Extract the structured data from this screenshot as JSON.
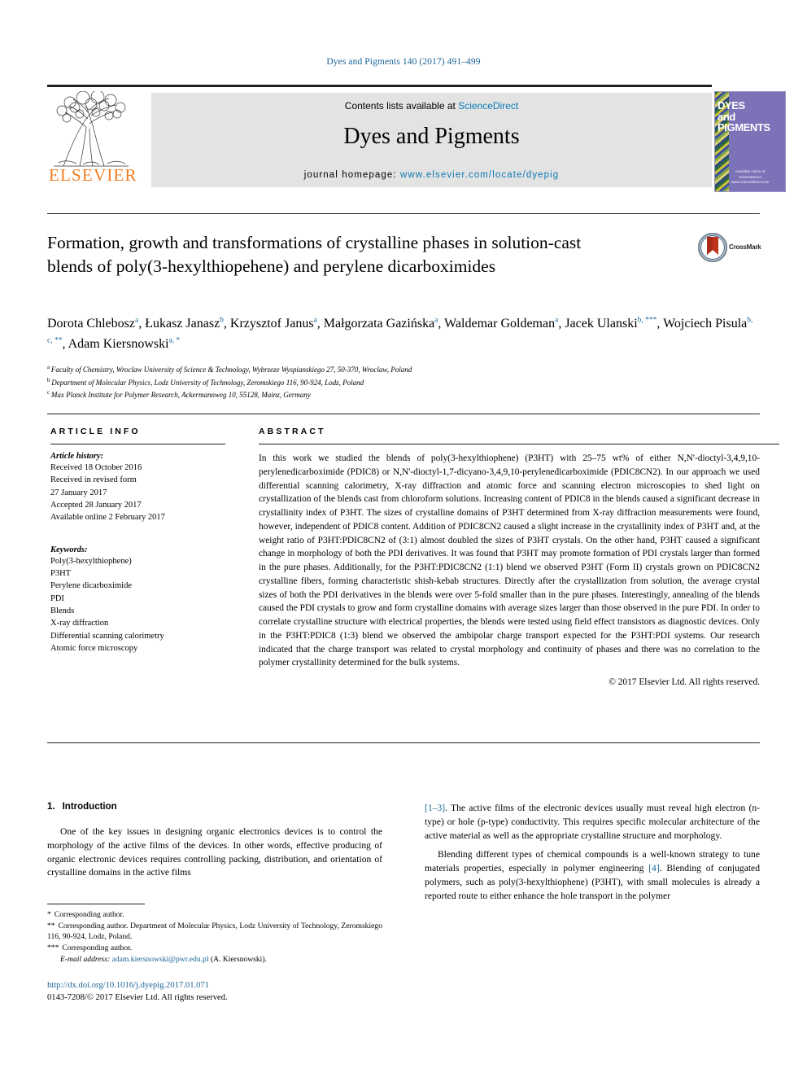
{
  "running_head": "Dyes and Pigments 140 (2017) 491–499",
  "masthead": {
    "contents_prefix": "Contents lists available at ",
    "sciencedirect": "ScienceDirect",
    "journal_title": "Dyes and Pigments",
    "homepage_label": "journal homepage: ",
    "homepage_url": "www.elsevier.com/locate/dyepig",
    "publisher": "ELSEVIER",
    "cover": {
      "line1": "DYES",
      "line2": "and",
      "line3": "PIGMENTS",
      "footer1": "Available online at",
      "footer2": "ScienceDirect",
      "footer3": "www.sciencedirect.com"
    },
    "accent_blue": "#0b7ab5",
    "elsevier_orange": "#f47b20",
    "cover_purple": "#7b72b8"
  },
  "title": "Formation, growth and transformations of crystalline phases in solution-cast blends of poly(3-hexylthiopehene) and perylene dicarboximides",
  "crossmark": {
    "label": "CrossMark"
  },
  "authors": [
    {
      "name": "Dorota Chlebosz",
      "marks": "a",
      "corr": ""
    },
    {
      "name": "Łukasz Janasz",
      "marks": "b",
      "corr": ""
    },
    {
      "name": "Krzysztof Janus",
      "marks": "a",
      "corr": ""
    },
    {
      "name": "Małgorzata Gazińska",
      "marks": "a",
      "corr": ""
    },
    {
      "name": "Waldemar Goldeman",
      "marks": "a",
      "corr": ""
    },
    {
      "name": "Jacek Ulanski",
      "marks": "b, ",
      "corr": "***"
    },
    {
      "name": "Wojciech Pisula",
      "marks": "b, c, ",
      "corr": "**"
    },
    {
      "name": "Adam Kiersnowski",
      "marks": "a, ",
      "corr": "*"
    }
  ],
  "affiliations": [
    {
      "mark": "a",
      "text": "Faculty of Chemistry, Wroclaw University of Science & Technology, Wybrzeze Wyspianskiego 27, 50-370, Wroclaw, Poland"
    },
    {
      "mark": "b",
      "text": "Department of Molecular Physics, Lodz University of Technology, Zeromskiego 116, 90-924, Lodz, Poland"
    },
    {
      "mark": "c",
      "text": "Max Planck Institute for Polymer Research, Ackermannweg 10, 55128, Mainz, Germany"
    }
  ],
  "article_info": {
    "kicker": "ARTICLE INFO",
    "history_label": "Article history:",
    "history": [
      "Received 18 October 2016",
      "Received in revised form",
      "27 January 2017",
      "Accepted 28 January 2017",
      "Available online 2 February 2017"
    ],
    "keywords_label": "Keywords:",
    "keywords": [
      "Poly(3-hexylthiophene)",
      "P3HT",
      "Perylene dicarboximide",
      "PDI",
      "Blends",
      "X-ray diffraction",
      "Differential scanning calorimetry",
      "Atomic force microscopy"
    ]
  },
  "abstract": {
    "kicker": "ABSTRACT",
    "text": "In this work we studied the blends of poly(3-hexylthiophene) (P3HT) with 25–75 wt% of either N,N'-dioctyl-3,4,9,10-perylenedicarboximide (PDIC8) or N,N'-dioctyl-1,7-dicyano-3,4,9,10-perylenedicarboximide (PDIC8CN2). In our approach we used differential scanning calorimetry, X-ray diffraction and atomic force and scanning electron microscopies to shed light on crystallization of the blends cast from chloroform solutions. Increasing content of PDIC8 in the blends caused a significant decrease in crystallinity index of P3HT. The sizes of crystalline domains of P3HT determined from X-ray diffraction measurements were found, however, independent of PDIC8 content. Addition of PDIC8CN2 caused a slight increase in the crystallinity index of P3HT and, at the weight ratio of P3HT:PDIC8CN2 of (3:1) almost doubled the sizes of P3HT crystals. On the other hand, P3HT caused a significant change in morphology of both the PDI derivatives. It was found that P3HT may promote formation of PDI crystals larger than formed in the pure phases. Additionally, for the P3HT:PDIC8CN2 (1:1) blend we observed P3HT (Form II) crystals grown on PDIC8CN2 crystalline fibers, forming characteristic shish-kebab structures. Directly after the crystallization from solution, the average crystal sizes of both the PDI derivatives in the blends were over 5-fold smaller than in the pure phases. Interestingly, annealing of the blends caused the PDI crystals to grow and form crystalline domains with average sizes larger than those observed in the pure PDI. In order to correlate crystalline structure with electrical properties, the blends were tested using field effect transistors as diagnostic devices. Only in the P3HT:PDIC8 (1:3) blend we observed the ambipolar charge transport expected for the P3HT:PDI systems. Our research indicated that the charge transport was related to crystal morphology and continuity of phases and there was no correlation to the polymer crystallinity determined for the bulk systems.",
    "copyright": "© 2017 Elsevier Ltd. All rights reserved."
  },
  "introduction": {
    "number": "1.",
    "heading": "Introduction",
    "para1_a": "One of the key issues in designing organic electronics devices is to control the morphology of the active films of the devices. In other words, effective producing of organic electronic devices requires controlling packing, distribution, and orientation of crystalline domains in the active films ",
    "para1_cite": "[1–3]",
    "para1_b": ". The active films of the electronic devices usually must reveal high electron (n-type) or hole (p-type) conductivity. This requires specific molecular architecture of the active material as well as the appropriate crystalline structure and morphology.",
    "para2_a": "Blending different types of chemical compounds is a well-known strategy to tune materials properties, especially in polymer engineering ",
    "para2_cite": "[4]",
    "para2_b": ". Blending of conjugated polymers, such as poly(3-hexylthiophene) (P3HT), with small molecules is already a reported route to either enhance the hole transport in the polymer"
  },
  "footnotes": [
    {
      "mark": "*",
      "text": "Corresponding author."
    },
    {
      "mark": "**",
      "text": "Corresponding author. Department of Molecular Physics, Lodz University of Technology, Zeromskiego 116, 90-924, Lodz, Poland."
    },
    {
      "mark": "***",
      "text": "Corresponding author."
    }
  ],
  "email_note": {
    "label": "E-mail address:",
    "address": "adam.kiersnowski@pwr.edu.pl",
    "owner": "(A. Kiersnowski)."
  },
  "imprint": {
    "doi": "http://dx.doi.org/10.1016/j.dyepig.2017.01.071",
    "issn": "0143-7208/© 2017 Elsevier Ltd. All rights reserved."
  }
}
